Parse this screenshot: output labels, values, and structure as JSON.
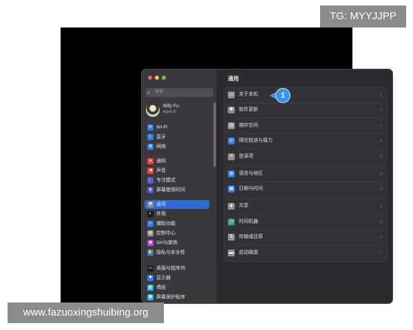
{
  "overlay": {
    "tg_tag": "TG: MYYJJPP",
    "watermark": "www.fazuoxingshuibing.org"
  },
  "window": {
    "traffic_lights": {
      "close": "#ed6a5e",
      "minimize": "#f5bf4f",
      "zoom": "#61c554"
    }
  },
  "sidebar": {
    "search_placeholder": "搜索",
    "profile": {
      "name": "Billy Fu",
      "subtitle": "Apple ID"
    },
    "items": [
      {
        "label": "Wi-Fi",
        "icon": "wifi-icon",
        "color": "#2f7de8"
      },
      {
        "label": "蓝牙",
        "icon": "bluetooth-icon",
        "color": "#2f7de8"
      },
      {
        "label": "网络",
        "icon": "globe-icon",
        "color": "#2f7de8"
      },
      {
        "label": "通知",
        "icon": "bell-icon",
        "color": "#e5483f"
      },
      {
        "label": "声音",
        "icon": "speaker-icon",
        "color": "#e5483f"
      },
      {
        "label": "专注模式",
        "icon": "moon-icon",
        "color": "#5d5ad6"
      },
      {
        "label": "屏幕使用时间",
        "icon": "hourglass-icon",
        "color": "#5d5ad6"
      },
      {
        "label": "通用",
        "icon": "gear-icon",
        "color": "#8e8e93",
        "selected": true
      },
      {
        "label": "外观",
        "icon": "appearance-icon",
        "color": "#1c1c1e"
      },
      {
        "label": "辅助功能",
        "icon": "accessibility-icon",
        "color": "#2f7de8"
      },
      {
        "label": "控制中心",
        "icon": "control-center-icon",
        "color": "#8e8e93"
      },
      {
        "label": "Siri与聚焦",
        "icon": "siri-icon",
        "color": "#b347d1"
      },
      {
        "label": "隐私与安全性",
        "icon": "hand-icon",
        "color": "#2f7de8"
      },
      {
        "label": "桌面与程序坞",
        "icon": "dock-icon",
        "color": "#1c1c1e"
      },
      {
        "label": "显示器",
        "icon": "display-icon",
        "color": "#2f7de8"
      },
      {
        "label": "墙纸",
        "icon": "wallpaper-icon",
        "color": "#34aadc"
      },
      {
        "label": "屏幕保护程序",
        "icon": "screensaver-icon",
        "color": "#34aadc"
      }
    ]
  },
  "main": {
    "title": "通用",
    "rows": [
      {
        "label": "关于本机",
        "icon": "laptop-icon",
        "color": "#8e8e93"
      },
      {
        "label": "软件更新",
        "icon": "gear-badge-icon",
        "color": "#8e8e93"
      },
      {
        "label": "储存空间",
        "icon": "storage-icon",
        "color": "#8e8e93"
      },
      {
        "label": "隔空投送与接力",
        "icon": "airdrop-icon",
        "color": "#2f7de8"
      },
      {
        "label": "登录项",
        "icon": "list-icon",
        "color": "#8e8e93"
      },
      {
        "label": "语言与地区",
        "icon": "globe-icon",
        "color": "#2f7de8"
      },
      {
        "label": "日期与时间",
        "icon": "calendar-icon",
        "color": "#2f7de8"
      },
      {
        "label": "共享",
        "icon": "share-icon",
        "color": "#8e8e93"
      },
      {
        "label": "时间机器",
        "icon": "time-machine-icon",
        "color": "#2f9e6b"
      },
      {
        "label": "传输或还原",
        "icon": "transfer-icon",
        "color": "#8e8e93"
      },
      {
        "label": "启动磁盘",
        "icon": "disk-icon",
        "color": "#8e8e93"
      }
    ],
    "callout_number": "1"
  }
}
